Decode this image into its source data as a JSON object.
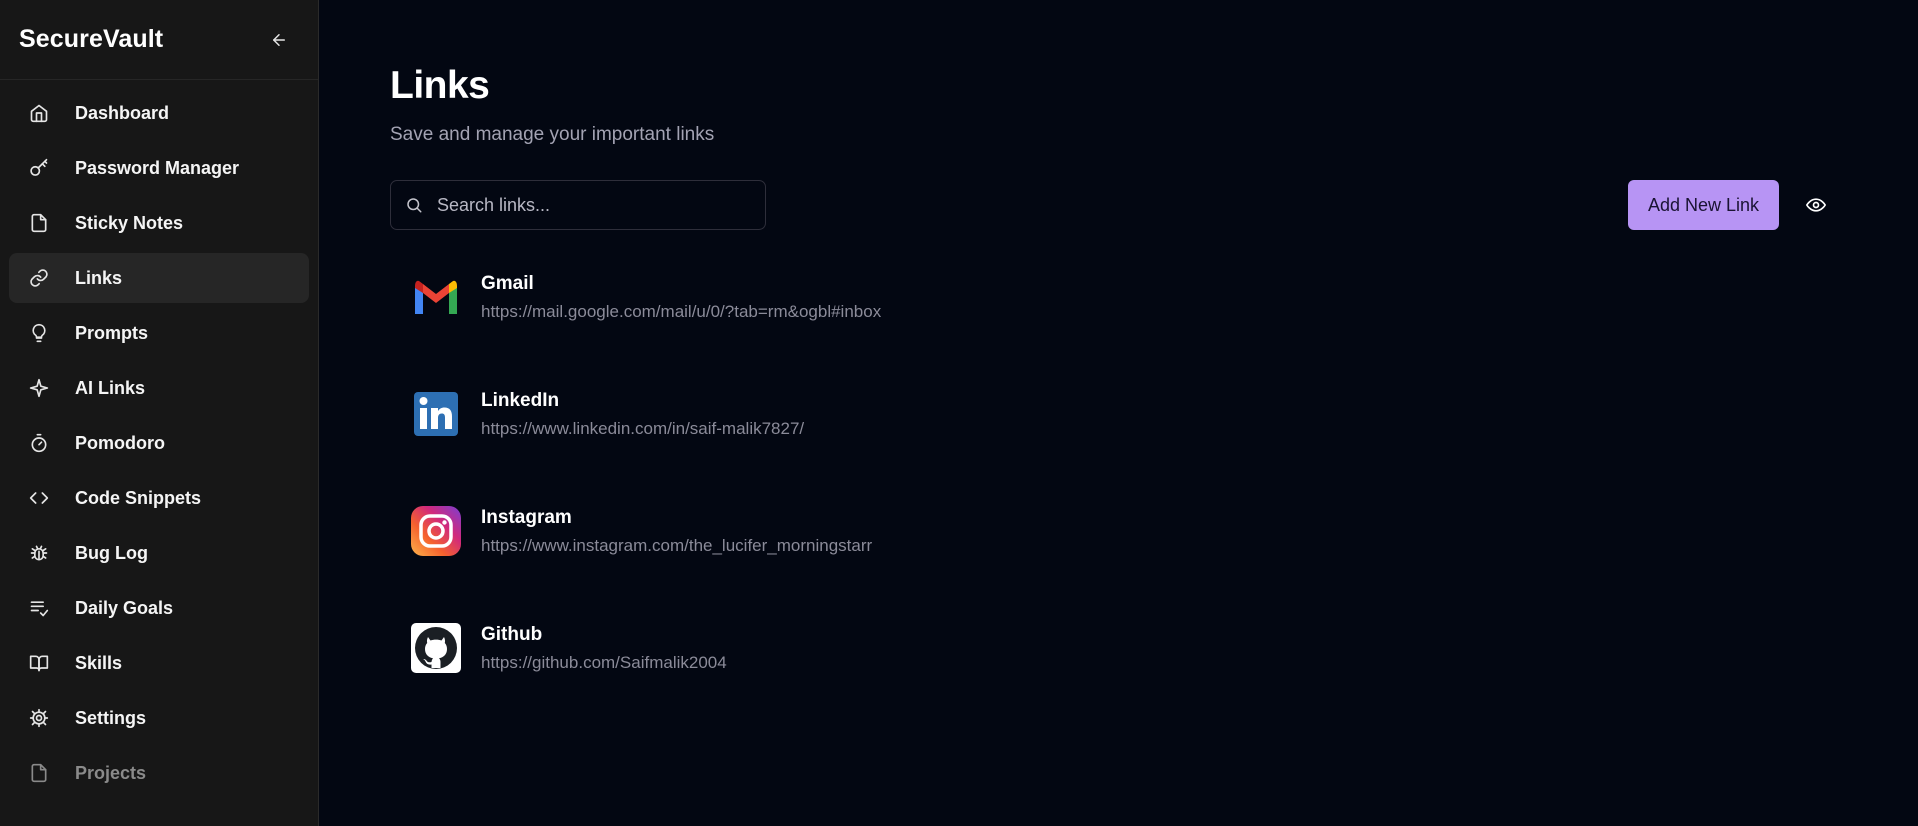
{
  "app": {
    "brand": "SecureVault"
  },
  "sidebar": {
    "items": [
      {
        "label": "Dashboard",
        "icon": "home-icon",
        "active": false
      },
      {
        "label": "Password Manager",
        "icon": "key-icon",
        "active": false
      },
      {
        "label": "Sticky Notes",
        "icon": "file-icon",
        "active": false
      },
      {
        "label": "Links",
        "icon": "link-icon",
        "active": true
      },
      {
        "label": "Prompts",
        "icon": "lightbulb-icon",
        "active": false
      },
      {
        "label": "AI Links",
        "icon": "sparkle-icon",
        "active": false
      },
      {
        "label": "Pomodoro",
        "icon": "timer-icon",
        "active": false
      },
      {
        "label": "Code Snippets",
        "icon": "code-icon",
        "active": false
      },
      {
        "label": "Bug Log",
        "icon": "bug-icon",
        "active": false
      },
      {
        "label": "Daily Goals",
        "icon": "list-check-icon",
        "active": false
      },
      {
        "label": "Skills",
        "icon": "book-icon",
        "active": false
      },
      {
        "label": "Settings",
        "icon": "gear-icon",
        "active": false
      },
      {
        "label": "Projects",
        "icon": "file-icon",
        "active": false
      }
    ]
  },
  "main": {
    "title": "Links",
    "subtitle": "Save and manage your important links",
    "search": {
      "placeholder": "Search links...",
      "value": ""
    },
    "add_button": "Add New Link",
    "links": [
      {
        "name": "Gmail",
        "url": "https://mail.google.com/mail/u/0/?tab=rm&ogbl#inbox",
        "logo": "gmail-logo"
      },
      {
        "name": "LinkedIn",
        "url": "https://www.linkedin.com/in/saif-malik7827/",
        "logo": "linkedin-logo"
      },
      {
        "name": "Instagram",
        "url": "https://www.instagram.com/the_lucifer_morningstarr",
        "logo": "instagram-logo"
      },
      {
        "name": "Github",
        "url": "https://github.com/Saifmalik2004",
        "logo": "github-logo"
      }
    ]
  },
  "colors": {
    "background": "#030712",
    "sidebar": "#171717",
    "accent": "#b794f4"
  }
}
